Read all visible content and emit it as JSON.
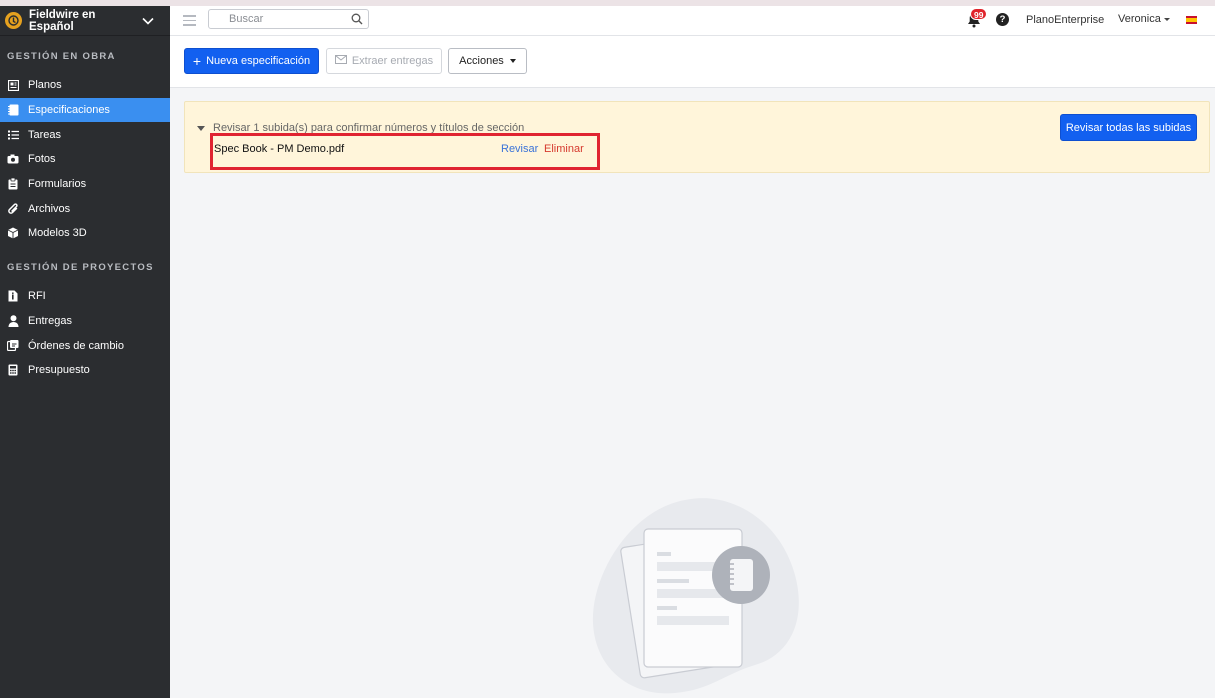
{
  "sidebar": {
    "app_title": "Fieldwire en Español",
    "section_obra": "GESTIÓN EN OBRA",
    "items_obra": [
      {
        "label": "Planos"
      },
      {
        "label": "Especificaciones"
      },
      {
        "label": "Tareas"
      },
      {
        "label": "Fotos"
      },
      {
        "label": "Formularios"
      },
      {
        "label": "Archivos"
      },
      {
        "label": "Modelos 3D"
      }
    ],
    "section_proyectos": "GESTIÓN DE PROYECTOS",
    "items_proyectos": [
      {
        "label": "RFI"
      },
      {
        "label": "Entregas"
      },
      {
        "label": "Órdenes de cambio"
      },
      {
        "label": "Presupuesto"
      }
    ],
    "active_item": "Especificaciones"
  },
  "header": {
    "search_placeholder": "Buscar",
    "notification_count": "99",
    "help_label": "?",
    "plan_label": "PlanoEnterprise",
    "user_name": "Veronica",
    "language_flag": "es"
  },
  "toolbar": {
    "new_spec_label": "Nueva especificación",
    "extract_label": "Extraer entregas",
    "actions_label": "Acciones"
  },
  "notice": {
    "message": "Revisar 1 subida(s) para confirmar números y títulos de sección",
    "upload_name": "Spec Book - PM Demo.pdf",
    "review_link": "Revisar",
    "delete_link": "Eliminar",
    "review_all_label": "Revisar todas las subidas"
  },
  "colors": {
    "sidebar_bg": "#2b2d30",
    "active_item": "#3a8ff0",
    "primary": "#1260f0",
    "notice_bg": "#fff5da",
    "highlight_border": "#e02431",
    "delete_link": "#d63a2f",
    "review_link": "#3a73d8"
  }
}
